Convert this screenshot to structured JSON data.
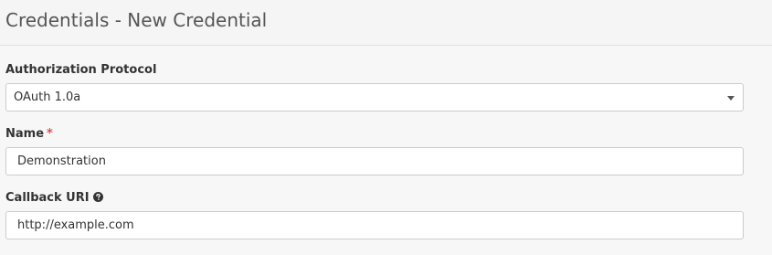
{
  "header": {
    "title": "Credentials - New Credential"
  },
  "form": {
    "auth_protocol": {
      "label": "Authorization Protocol",
      "value": "OAuth 1.0a",
      "icon": "chevron-down-icon"
    },
    "name": {
      "label": "Name",
      "required_mark": "*",
      "value": "Demonstration"
    },
    "callback_uri": {
      "label": "Callback URI",
      "help_icon": "question-circle-icon",
      "value": "http://example.com"
    }
  },
  "colors": {
    "required": "#d9534f",
    "border": "#cccccc",
    "background": "#f7f7f7"
  }
}
